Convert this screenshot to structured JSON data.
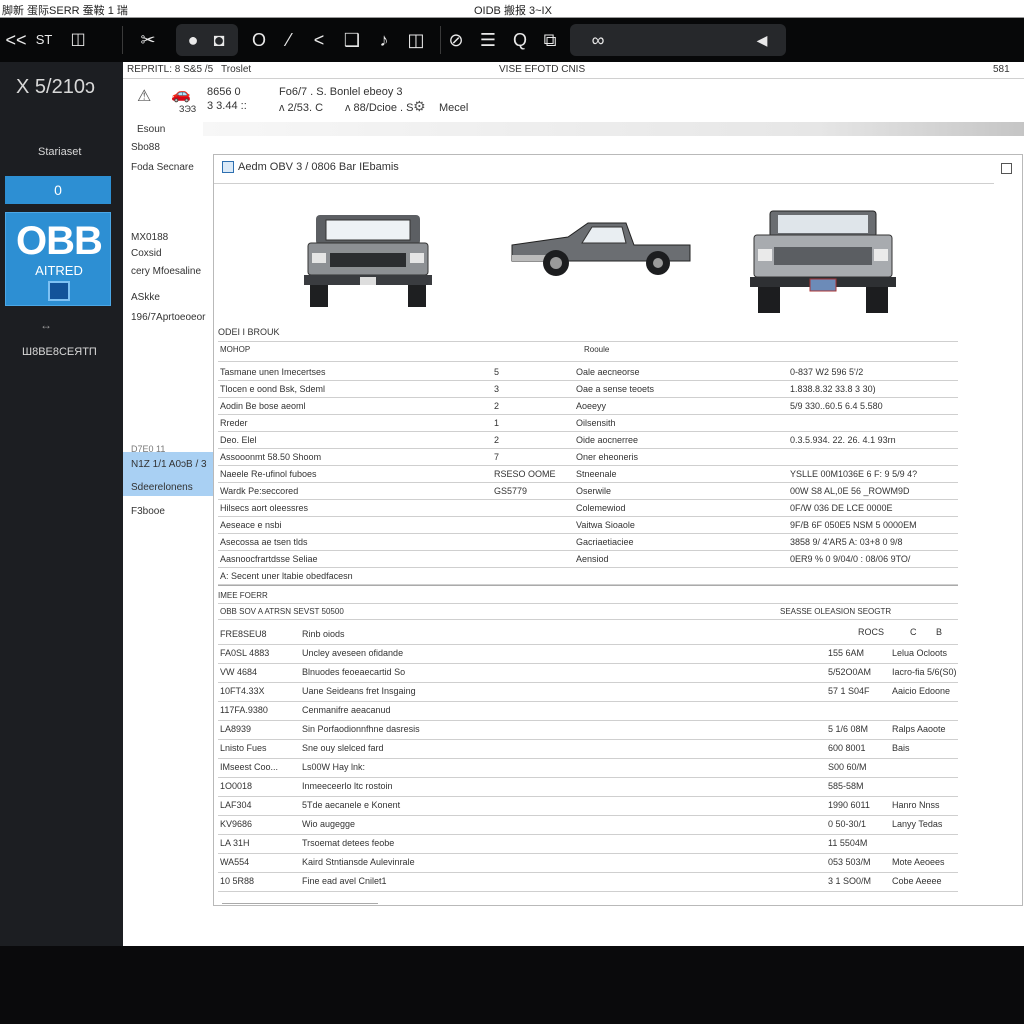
{
  "window": {
    "title_left": "脚新 蛋际SERR 蚕鞍 1 瑞",
    "title_center": "OIDB 搬报 3~IX"
  },
  "toolbar": {
    "nav": [
      "<<",
      "ST",
      "◫"
    ],
    "tools": [
      "✂",
      "●",
      "◘",
      "O",
      "⁄",
      "<",
      "❑",
      "♪"
    ],
    "tools2": [
      "⊘",
      "☰",
      "Q",
      "⧉"
    ],
    "media": [
      "∞",
      "◀"
    ]
  },
  "sidebar": {
    "code": "X 5/210ɔ",
    "label": "Stariaset",
    "badge": "0",
    "logo_text": "OBB",
    "logo_sub": "AITRED",
    "arrow": "↔",
    "footer": "Ш8ВЕ8СЕЯТП"
  },
  "main": {
    "crumb_left": "REPRITL: 8 S&5 /5",
    "crumb_mid": "Troslet",
    "crumb_center": "VISE EFOTD CNIS",
    "crumb_right": "581",
    "hdr": {
      "a": "8656 0",
      "b": "3 3.44 ::",
      "c": "ЗЭЗ",
      "d": "Fo6/7 . S. Bonlel ebeoy 3",
      "e": "ᴧ 2/53.   C",
      "f": "ᴧ 88/Dcioe . S",
      "g": "Mecel"
    },
    "section_label": "Esoun"
  },
  "leftnav": {
    "items": [
      "Sbo88",
      "Foda Secnare",
      "MX0188",
      "Coxsid",
      "cery Mfoesaline",
      "ASkke",
      "196/7Aprtoeoeor",
      "D7E0 11",
      "N1Z 1/1 A0ɔB / 3",
      "Sdeerelonens",
      "F3booe"
    ]
  },
  "panel": {
    "title": "Aedm OBV 3 / 0806 Bar IEbamis",
    "section1": "ODEI I BROUK",
    "header_left": "МОНОР",
    "header_right": "Rooule",
    "table1": [
      [
        "Tasmane unen Imecertses",
        "5",
        "Oale aecneorse",
        "0-837 W2 596 5'/2"
      ],
      [
        "Tlocen e oond Bsk, Sdeml",
        "3",
        "Oae a sense teoets",
        "1.838.8.32 33.8 3 30)"
      ],
      [
        "Aodin Be bose aeoml",
        "2",
        "Aoeeyy",
        "5/9 330..60.5 6.4 5.580"
      ],
      [
        "Rreder",
        "1",
        "Oilsensith",
        ""
      ],
      [
        "Deo. Elel",
        "2",
        "Oide aocnerree",
        "0.3.5.934. 22. 26. 4.1 93rn"
      ],
      [
        "Assooonmt 58.50 Shoom",
        "7",
        "Oner eheoneris",
        ""
      ],
      [
        "Naeele Re-ufinol fuboes",
        "RSESO OOME",
        "Stneenale",
        "YSLLE 00M1036E 6 F: 9 5/9 4?"
      ],
      [
        "Wardk Pe:seccored",
        "GS5779",
        "Oserwile",
        "00W S8 AL,0E 56 _ROWM9D"
      ],
      [
        "Hilsecs aort oleessres",
        "",
        "Colemewiod",
        "0F/W 036 DE LCE 0000E"
      ],
      [
        "Aeseace e nsbi",
        "",
        "Vaitwa Sioaole",
        "9F/B 6F 050E5 NSM 5 0000EM"
      ],
      [
        "Asecossa ae tsen tlds",
        "",
        "Gacriaetiaciee",
        "3858 9/ 4'AR5 A: 03+8 0 9/8"
      ],
      [
        "Aasnoocfrartdsse Seliae",
        "",
        "Aensiod",
        "0ER9 % 0 9/04/0 : 08/06 9TO/"
      ],
      [
        "A: Secent uner ltabie obedfacesn",
        "",
        "",
        ""
      ]
    ],
    "section2": "IMEE FOERR",
    "table2_header_left": "OBB SOV A ATRSN SEVST 50500",
    "table2_header_right": "SEASSE OLEASION SEOGTR",
    "table2_col": [
      "ROCS",
      "C",
      "B"
    ],
    "table2": [
      [
        "FRE8SEU8",
        "Rinb oiods",
        "",
        ""
      ],
      [
        "FA0SL 4883",
        "Uncley aveseen ofidande",
        "155 6AM",
        "Lelua Ocloots"
      ],
      [
        "VW 4684",
        "Blnuodes feoeaecartid So",
        "5/52O0AM",
        "Iacro-fia 5/6(S0)"
      ],
      [
        "10FT4.33X",
        "Uane Seideans fret Insgaing",
        "57 1 S04F",
        "Aaicio Edoone"
      ],
      [
        "117FA.9380",
        "Cenmanifre aeacanud",
        "",
        ""
      ],
      [
        "LA8939",
        "Sin Porfaodionnfhne dasresis",
        "5 1/6 08M",
        "Ralps Aaoote"
      ],
      [
        "Lnisto Fues",
        "Sne ouy slelced fard",
        "600 8001",
        "Bais"
      ],
      [
        "IMseest Coo...",
        "Ls00W Hay lnk:",
        "S00 60/M",
        ""
      ],
      [
        "1O0018",
        "Inmeeceerlo ltc rostoin",
        "585-58M",
        ""
      ],
      [
        "LAF304",
        "5Tde aecanele e Konent",
        "1990 6011",
        "Hanro Nnss"
      ],
      [
        "KV9686",
        "Wio augegge",
        "0 50-30/1",
        "Lanyy Tedas"
      ],
      [
        "LA 31H",
        "Trsoemat detees feobe",
        "11 5504M",
        ""
      ],
      [
        "WA554",
        "Kaird Stntiansde Aulevinrale",
        "053 503/M",
        "Mote Aeoees"
      ],
      [
        "10 5R88",
        "Fine ead avel Cnilet1",
        "3 1 SO0/M",
        "Cobe Aeeee"
      ]
    ]
  }
}
